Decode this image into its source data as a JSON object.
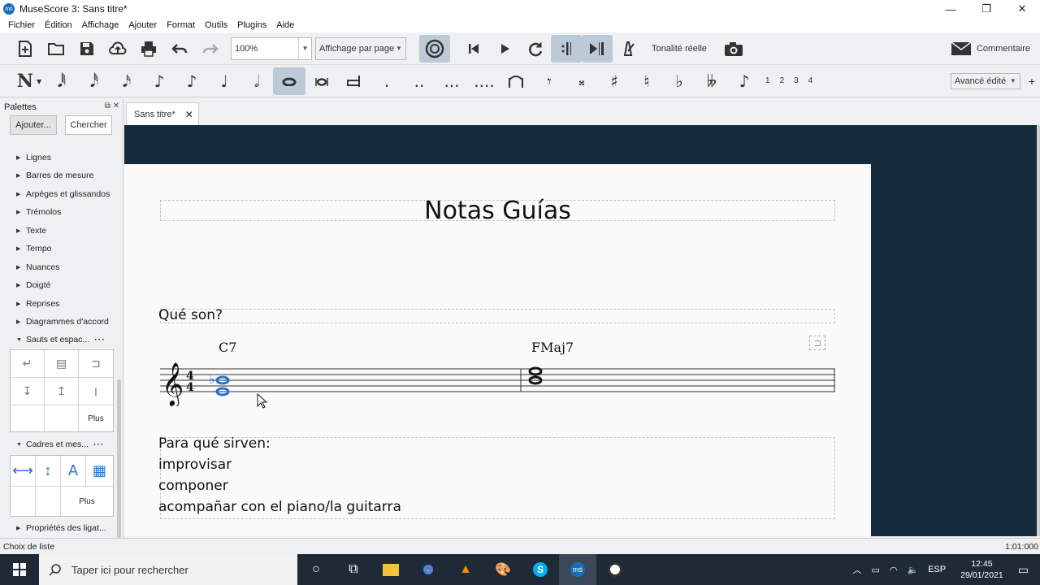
{
  "window": {
    "title": "MuseScore 3: Sans titre*",
    "minimize": "—",
    "restore": "❐",
    "close": "✕"
  },
  "menu": [
    "Fichier",
    "Édition",
    "Affichage",
    "Ajouter",
    "Format",
    "Outils",
    "Plugins",
    "Aide"
  ],
  "toolbar": {
    "zoom_value": "100%",
    "view_mode": "Affichage par page",
    "concert_pitch_label": "Tonalité réelle",
    "comment_label": "Commentaire",
    "workspace": "Avancé édité",
    "voices": [
      "1",
      "2",
      "3",
      "4"
    ]
  },
  "palettes": {
    "title": "Palettes",
    "add_button": "Ajouter...",
    "search_button": "Chercher",
    "items": [
      "Lignes",
      "Barres de mesure",
      "Arpèges et glissandos",
      "Trémolos",
      "Texte",
      "Tempo",
      "Nuances",
      "Doigté",
      "Reprises",
      "Diagrammes d'accord"
    ],
    "expanded1": "Sauts et espac...",
    "expanded2": "Cadres et mes...",
    "more_label": "Plus",
    "last_item": "Propriétés des ligat..."
  },
  "tab": {
    "label": "Sans titre*",
    "close": "✕"
  },
  "score": {
    "title": "Notas Guías",
    "subtitle": "Qué son?",
    "chord1": "C7",
    "chord2": "FMaj7",
    "text_lines": [
      "Para qué sirven:",
      "improvisar",
      "componer",
      "acompañar con el piano/la guitarra"
    ]
  },
  "status": {
    "left": "Choix de liste",
    "right": "1:01:000"
  },
  "taskbar": {
    "search_placeholder": "Taper ici pour rechercher",
    "language": "ESP",
    "time": "12:45",
    "date": "29/01/2021"
  }
}
